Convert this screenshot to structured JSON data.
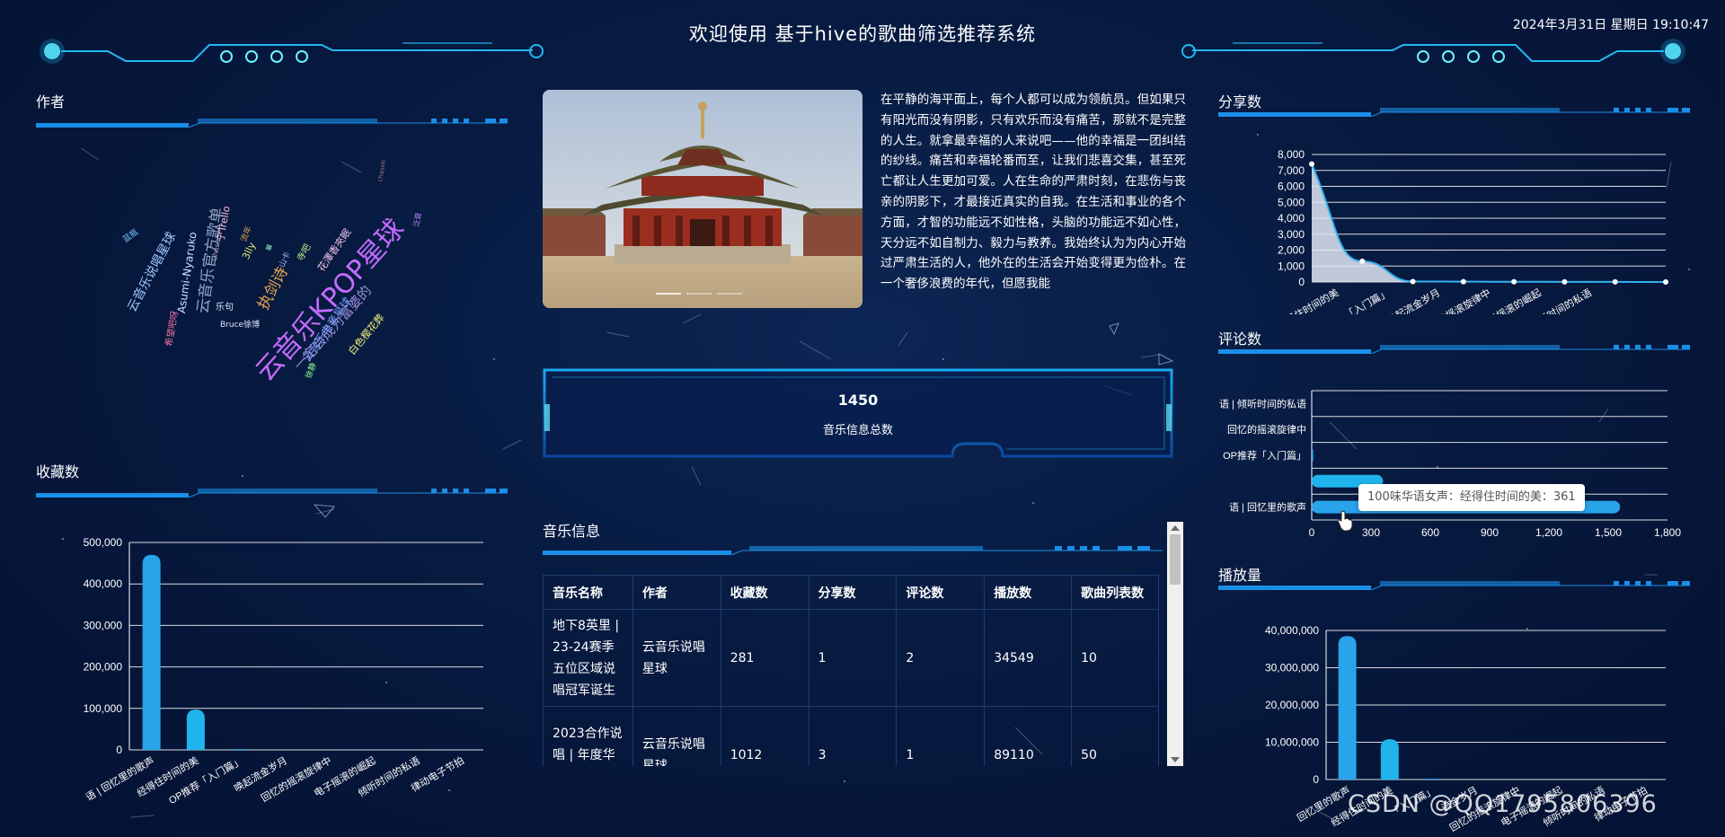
{
  "header": {
    "title": "欢迎使用 基于hive的歌曲筛选推荐系统",
    "datetime": "2024年3月31日 星期日 19:10:47"
  },
  "panels": {
    "author": "作者",
    "favorites": "收藏数",
    "shares": "分享数",
    "comments": "评论数",
    "plays": "播放量",
    "music_info": "音乐信息"
  },
  "author_cloud": [
    {
      "text": "云音乐KPOP星球",
      "color": "#c36bff"
    },
    {
      "text": "云音乐官方歌单",
      "color": "#8fa3c4"
    },
    {
      "text": "云音乐说唱星球",
      "color": "#a2c8ff"
    },
    {
      "text": "执剑诗",
      "color": "#e9a64f"
    },
    {
      "text": "一定会成为富婆的",
      "color": "#9b8ed6"
    },
    {
      "text": "云音乐电音星球",
      "color": "#7aa0ff"
    },
    {
      "text": "Asumi-Nyaruko",
      "color": "#cfe0ff"
    },
    {
      "text": "Chaseh",
      "color": "#9d8fb5"
    },
    {
      "text": "希望吧呀",
      "color": "#f06fa0"
    },
    {
      "text": "宁Trello",
      "color": "#f2c2dd"
    },
    {
      "text": "3lly",
      "color": "#d8e77d"
    },
    {
      "text": "乐句",
      "color": "#dfe6ff"
    },
    {
      "text": "Bruce徐博",
      "color": "#dfe6ff"
    },
    {
      "text": "白色樱花葬",
      "color": "#f0f07a"
    },
    {
      "text": "花澤香夾眠",
      "color": "#f3c5ea"
    },
    {
      "text": "寺吧",
      "color": "#b6ef8a"
    },
    {
      "text": "蓝瓶",
      "color": "#7dc7ff"
    },
    {
      "text": "流年",
      "color": "#d8a24e"
    },
    {
      "text": "山卡",
      "color": "#a1b6ff"
    },
    {
      "text": "chaseh",
      "color": "#9c6e85"
    },
    {
      "text": "泛音",
      "color": "#c58cff"
    },
    {
      "text": "徐静",
      "color": "#90ff9a"
    },
    {
      "text": "幂",
      "color": "#a9ffe0"
    }
  ],
  "intro_text": "在平静的海平面上，每个人都可以成为领航员。但如果只有阳光而没有阴影，只有欢乐而没有痛苦，那就不是完整的人生。就拿最幸福的人来说吧——他的幸福是一团纠结的纱线。痛苦和幸福轮番而至，让我们悲喜交集，甚至死亡都让人生更加可爱。人在生命的严肃时刻，在悲伤与丧亲的阴影下，才最接近真实的自我。在生活和事业的各个方面，才智的功能远不如性格，头脑的功能远不如心性，天分远不如自制力、毅力与教养。我始终认为为内心开始过严肃生活的人，他外在的生活会开始变得更为俭朴。在一个奢侈浪费的年代，但愿我能",
  "stat": {
    "value": "1450",
    "label": "音乐信息总数"
  },
  "music_table": {
    "headers": [
      "音乐名称",
      "作者",
      "收藏数",
      "分享数",
      "评论数",
      "播放数",
      "歌曲列表数"
    ],
    "rows": [
      [
        "地下8英里 | 23-24赛季五位区域说唱冠军诞生",
        "云音乐说唱星球",
        "281",
        "1",
        "2",
        "34549",
        "10"
      ],
      [
        "2023合作说唱 | 年度华语说唱神级",
        "云音乐说唱星球",
        "1012",
        "3",
        "1",
        "89110",
        "50"
      ]
    ]
  },
  "tooltip": {
    "text": "100味华语女声：经得住时间的美：361"
  },
  "watermark": "CSDN @QQ1795806396",
  "colors": {
    "accent": "#1a8fe8",
    "bar": "#29a3ea",
    "frame": "#21b8f4",
    "glow": "#6cf4ff"
  },
  "chart_data": [
    {
      "id": "favorites",
      "type": "bar",
      "categories": [
        "100味华语 | 回忆里的歌声",
        "100味华语女声：经得住时间的美",
        "KPOP推荐「入门篇」",
        "「唤醒」唤起流金岁月",
        "回忆的摇滚旋律中",
        "电子摇滚的崛起",
        "倾听时间的私语",
        "律动电子节拍"
      ],
      "tick_labels": [
        "语 | 回忆里的歌声",
        "经得住时间的美",
        "OP推荐「入门篇」",
        "唤起流金岁月",
        "回忆的摇滚旋律中",
        "电子摇滚的崛起",
        "倾听时间的私语",
        "律动电子节拍"
      ],
      "values": [
        470000,
        97000,
        2000,
        1000,
        800,
        600,
        400,
        300
      ],
      "yticks": [
        "0",
        "100,000",
        "200,000",
        "300,000",
        "400,000",
        "500,000"
      ],
      "ylim": [
        0,
        500000
      ]
    },
    {
      "id": "shares",
      "type": "area",
      "categories": [
        "100味华语 | 回忆里的歌声",
        "经得住时间的美",
        "KPOP推荐「入门篇」",
        "流金岁月",
        "回忆的摇滚旋律中",
        "电子摇滚的崛起",
        "倾听时间的私语"
      ],
      "tick_labels": [
        "得住时间的美",
        "「入门篇」",
        "唤起流金岁月",
        "回忆的摇滚旋律中",
        "电子摇滚的崛起",
        "倾听时间的私语"
      ],
      "values": [
        7400,
        1300,
        30,
        20,
        15,
        10,
        5,
        2
      ],
      "yticks": [
        "0",
        "1,000",
        "2,000",
        "3,000",
        "4,000",
        "5,000",
        "6,000",
        "7,000",
        "8,000"
      ],
      "ylim": [
        0,
        8000
      ]
    },
    {
      "id": "comments",
      "type": "bar-horizontal",
      "categories": [
        "倾听时间的私语",
        "回忆的摇滚旋律中",
        "KPOP推荐「入门篇」",
        "100味华语女声：经得住时间的美",
        "100味华语 | 回忆里的歌声"
      ],
      "tick_labels": [
        "语 | 倾听时间的私语",
        "回忆的摇滚旋律中",
        "OP推荐「入门篇」",
        "",
        "语 | 回忆里的歌声"
      ],
      "values": [
        0,
        0,
        8,
        361,
        1560
      ],
      "xticks": [
        "0",
        "300",
        "600",
        "900",
        "1,200",
        "1,500",
        "1,800"
      ],
      "xlim": [
        0,
        1800
      ]
    },
    {
      "id": "plays",
      "type": "bar",
      "categories": [
        "回忆里的歌声",
        "经得住时间的美",
        "「入门篇」",
        "流金岁月",
        "回忆的摇滚旋律中",
        "电子摇滚的崛起",
        "倾听时间的私语",
        "律动电子节拍"
      ],
      "tick_labels": [
        "回忆里的歌声",
        "经得住时间的美",
        "「入门篇」",
        "流金岁月",
        "回忆的摇滚旋律中",
        "电子摇滚的崛起",
        "倾听时间的私语",
        "律动电子节拍"
      ],
      "values": [
        38500000,
        10800000,
        200000,
        100000,
        80000,
        60000,
        50000,
        40000
      ],
      "yticks": [
        "0",
        "10,000,000",
        "20,000,000",
        "30,000,000",
        "40,000,000"
      ],
      "ylim": [
        0,
        40000000
      ]
    }
  ]
}
